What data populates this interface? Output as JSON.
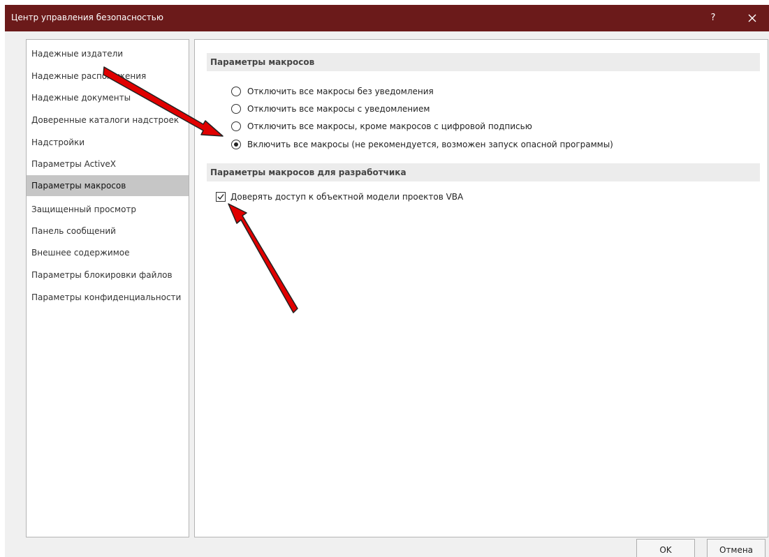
{
  "window": {
    "title": "Центр управления безопасностью",
    "help_label": "?",
    "titlebar_color": "#6b1a1a"
  },
  "sidebar": {
    "items": [
      {
        "label": "Надежные издатели"
      },
      {
        "label": "Надежные расположения"
      },
      {
        "label": "Надежные документы"
      },
      {
        "label": "Доверенные каталоги надстроек"
      },
      {
        "label": "Надстройки"
      },
      {
        "label": "Параметры ActiveX"
      },
      {
        "label": "Параметры макросов",
        "active": true
      },
      {
        "label": "Защищенный просмотр"
      },
      {
        "label": "Панель сообщений"
      },
      {
        "label": "Внешнее содержимое"
      },
      {
        "label": "Параметры блокировки файлов"
      },
      {
        "label": "Параметры конфиденциальности"
      }
    ]
  },
  "macro_settings": {
    "header": "Параметры макросов",
    "options": [
      {
        "label": "Отключить все макросы без уведомления",
        "selected": false
      },
      {
        "label": "Отключить все макросы с уведомлением",
        "selected": false
      },
      {
        "label": "Отключить все макросы, кроме макросов с цифровой подписью",
        "selected": false
      },
      {
        "label": "Включить все макросы (не рекомендуется, возможен запуск опасной программы)",
        "selected": true
      }
    ]
  },
  "developer_settings": {
    "header": "Параметры макросов для разработчика",
    "trust_vba_label": "Доверять доступ к объектной модели проектов VBA",
    "trust_vba_checked": true
  },
  "buttons": {
    "ok_label": "OK",
    "cancel_label": "Отмена"
  },
  "annotation_color": "#e00000"
}
